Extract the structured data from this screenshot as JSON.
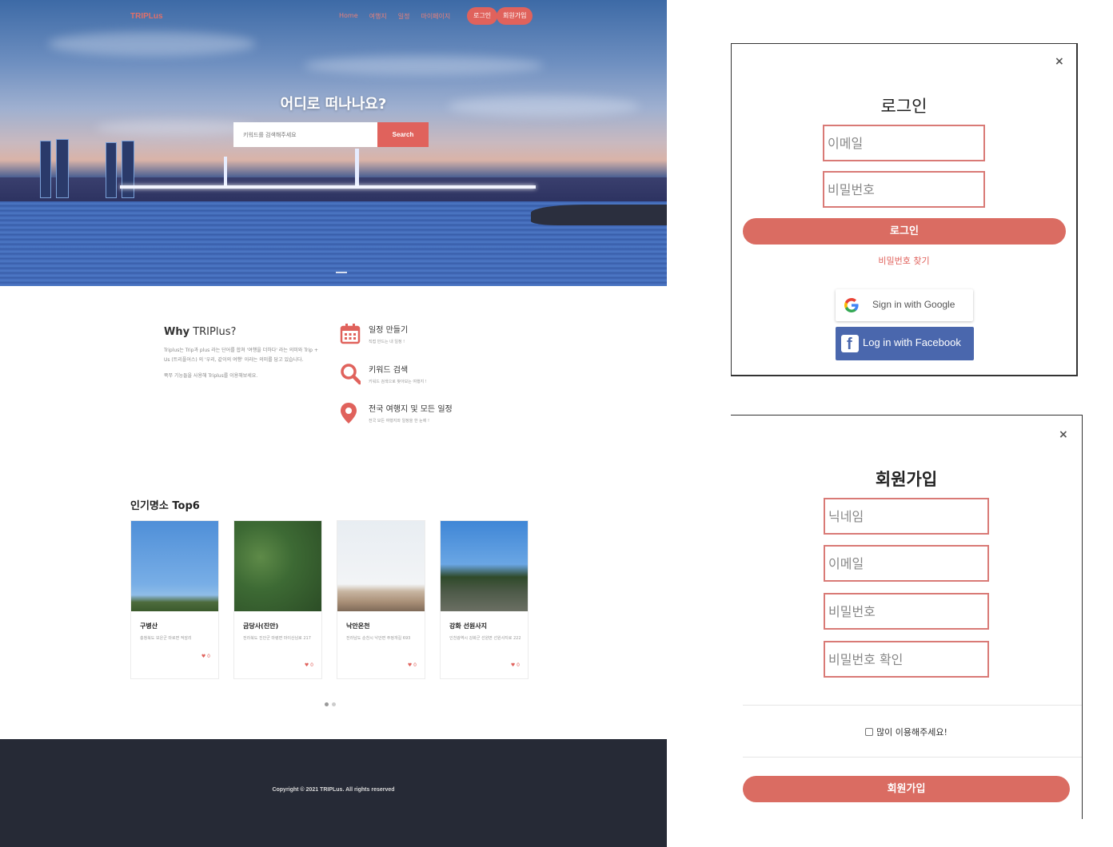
{
  "site": {
    "brand": "TRIPLus",
    "nav": {
      "links": [
        "Home",
        "여행지",
        "일정",
        "마이페이지"
      ],
      "login": "로그인",
      "signup": "회원가입"
    },
    "hero": {
      "title": "어디로 떠나나요?",
      "search_placeholder": "키워드를 검색해주세요",
      "search_button": "Search"
    },
    "why": {
      "title_bold": "Why",
      "title_rest": " TRIPlus?",
      "desc": "Triplus는 Trip과 plus 라는 단어를 합쳐 '여행을 더하다' 라는 의미와 Trip + Us (트리플어스) 의 '우리, 같이의 여행' 이라는 의미를 담고 있습니다.",
      "desc2": "쭉쭈 기능들을 사용해 Triplus를 이용해보세요."
    },
    "features": [
      {
        "title": "일정 만들기",
        "desc": "직접 만드는 내 일정 !",
        "icon": "calendar-icon"
      },
      {
        "title": "키워드 검색",
        "desc": "키워드 검색으로 찾아보는 여행지 !",
        "icon": "search-icon"
      },
      {
        "title": "전국 여행지 및 모든 일정",
        "desc": "전국 모든 여행지와 일정을 한 눈에 !",
        "icon": "map-pin-icon"
      }
    ],
    "top6": {
      "title": "인기명소 Top6",
      "cards": [
        {
          "name": "구병산",
          "addr": "충청북도 보은군 마로면 적암리",
          "likes": "0"
        },
        {
          "name": "금당사(진안)",
          "addr": "전라북도 진안군 마령면 마이산남로 217",
          "likes": "0"
        },
        {
          "name": "낙안온천",
          "addr": "전라남도 순천시 낙안면 주정개길 693",
          "likes": "0"
        },
        {
          "name": "강화 선원사지",
          "addr": "인천광역시 강화군 선원면 선원사지로 222",
          "likes": "0"
        }
      ]
    },
    "footer": "Copyright © 2021 TRIPLus. All rights reserved"
  },
  "login_modal": {
    "close": "×",
    "title": "로그인",
    "email_placeholder": "이메일",
    "password_placeholder": "비밀번호",
    "submit": "로그인",
    "forgot": "비밀번호 찾기",
    "google": "Sign in with Google",
    "facebook": "Log in with Facebook"
  },
  "signup_modal": {
    "close": "×",
    "title": "회원가입",
    "nickname_placeholder": "닉네임",
    "email_placeholder": "이메일",
    "password_placeholder": "비밀번호",
    "password_confirm_placeholder": "비밀번호 확인",
    "agree": "많이 이용해주세요!",
    "submit": "회원가입"
  },
  "colors": {
    "accent": "#e0625c",
    "footer": "#262a36",
    "facebook": "#4a67ad"
  }
}
